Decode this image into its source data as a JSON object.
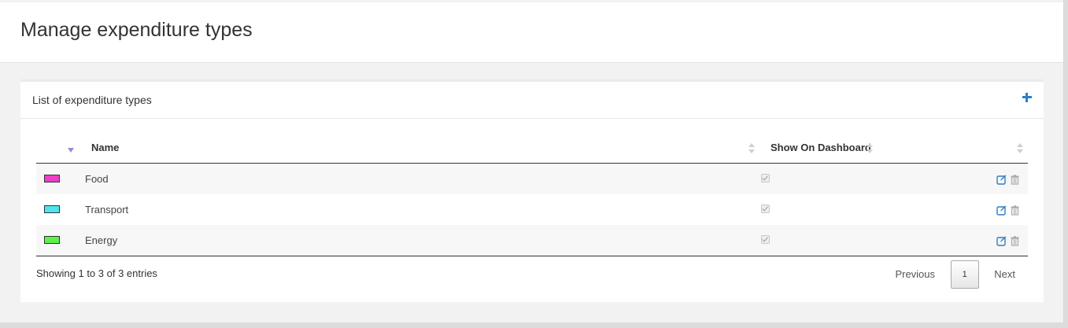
{
  "header": {
    "title": "Manage expenditure types"
  },
  "panel": {
    "title": "List of expenditure types",
    "add_icon": "plus-icon"
  },
  "table": {
    "columns": {
      "name": "Name",
      "show_on_dashboard": "Show On Dashboard"
    },
    "rows": [
      {
        "color": "#ee3ec8",
        "name": "Food",
        "show_on_dashboard": true
      },
      {
        "color": "#4fe3ee",
        "name": "Transport",
        "show_on_dashboard": true
      },
      {
        "color": "#5ef04d",
        "name": "Energy",
        "show_on_dashboard": true
      }
    ]
  },
  "footer": {
    "info": "Showing 1 to 3 of 3 entries",
    "previous": "Previous",
    "current_page": "1",
    "next": "Next"
  },
  "colors": {
    "accent": "#2f7fc4",
    "sort_active": "#8f8fd9"
  }
}
